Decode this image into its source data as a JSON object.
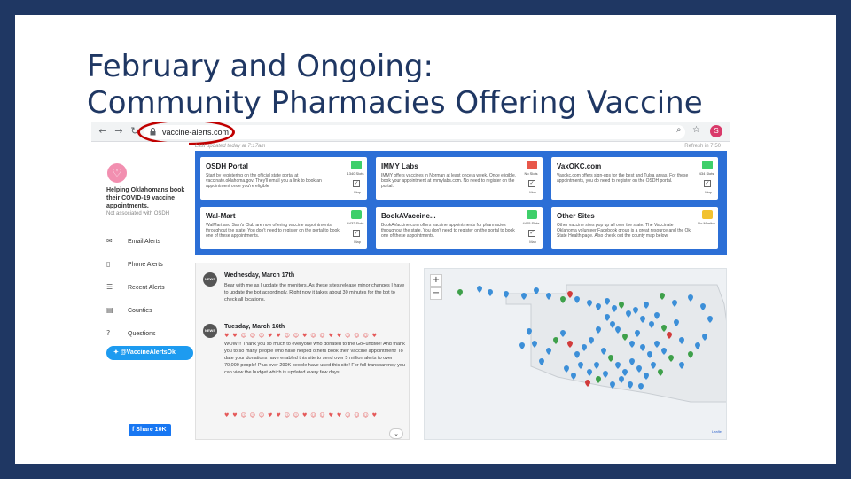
{
  "slide": {
    "title_line1": "February and Ongoing:",
    "title_line2": "Community Pharmacies Offering Vaccine"
  },
  "browser": {
    "url": "vaccine-alerts.com",
    "profile_initial": "S",
    "icons": [
      "back-icon",
      "forward-icon",
      "reload-icon",
      "lock-icon",
      "zoom-icon",
      "star-icon",
      "profile-icon"
    ]
  },
  "sidebar": {
    "tagline": "Helping Oklahomans book their COVID-19 vaccine appointments.",
    "affiliation": "Not associated with OSDH",
    "items": [
      {
        "label": "Email Alerts",
        "icon": "email-icon"
      },
      {
        "label": "Phone Alerts",
        "icon": "phone-icon"
      },
      {
        "label": "Recent Alerts",
        "icon": "list-icon"
      },
      {
        "label": "Counties",
        "icon": "map-icon"
      },
      {
        "label": "Questions",
        "icon": "question-icon"
      }
    ],
    "twitter_label": "@VaccineAlertsOk",
    "facebook_label": "Share 10K"
  },
  "header": {
    "last_updated": "Last updated today at 7:17am",
    "refresh": "Refresh in 7:50"
  },
  "cards": [
    {
      "title": "OSDH Portal",
      "status_color": "#3ecf6a",
      "status_label": "1340 Slots",
      "desc": "Start by registering on the official state portal at vaccinate.oklahoma.gov. They'll email you a link to book an appointment once you're eligible",
      "map_label": "Map"
    },
    {
      "title": "IMMY Labs",
      "status_color": "#e8574a",
      "status_label": "No Slots",
      "desc": "IMMY offers vaccines in Norman at least once a week. Once eligible, book your appointment at immylabs.com. No need to register on the portal.",
      "map_label": "Map"
    },
    {
      "title": "VaxOKC.com",
      "status_color": "#3ecf6a",
      "status_label": "434 Slots",
      "desc": "Vaxokc.com offers sign-ups for the best and Tulsa areas. For these appointments, you do need to register on the OSDH portal.",
      "map_label": "Map"
    },
    {
      "title": "Wal-Mart",
      "status_color": "#3ecf6a",
      "status_label": "4432 Slots",
      "desc": "WalMart and Sam's Club are now offering vaccine appointments throughout the state. You don't need to register on the portal to book one of these appointments.",
      "map_label": "Map"
    },
    {
      "title": "BookAVaccine...",
      "status_color": "#3ecf6a",
      "status_label": "4405 Slots",
      "desc": "BookAVaccine.com offers vaccine appointments for pharmacies throughout the state. You don't need to register on the portal to book one of these appointments.",
      "map_label": "Map"
    },
    {
      "title": "Other Sites",
      "status_color": "#f2c230",
      "status_label": "No Monitor",
      "desc": "Other vaccine sites pop up all over the state. The Vaccinate Oklahoma volunteer Facebook group is a great resource and the Ok State Health page. Also check out the county map below.",
      "map_label": ""
    }
  ],
  "news": [
    {
      "avatar": "NEWS",
      "date": "Wednesday, March 17th",
      "body": "Bear with me as I update the monitors. As these sites release minor changes I have to update the bot accordingly. Right now it takes about 30 minutes for the bot to check all locations."
    },
    {
      "avatar": "NEWS",
      "date": "Tuesday, March 16th",
      "body": "WOW!!! Thank you so much to everyone who donated to the GoFundMe! And thank you to so many people who have helped others book their vaccine appointment! To date your donations have enabled this site to send over 5 million alerts to over 70,000 people! Plus over 290K people have used this site! For full transparency you can view the budget which is updated every few days."
    }
  ],
  "emoji": "♥ ♥ ☺ ☺ ☺ ♥ ♥ ☺ ☺ ♥ ☺ ☺ ♥ ♥ ☺ ☺ ☺ ♥",
  "map": {
    "zoom_in": "+",
    "zoom_out": "−",
    "attribution": "Leaflet"
  }
}
